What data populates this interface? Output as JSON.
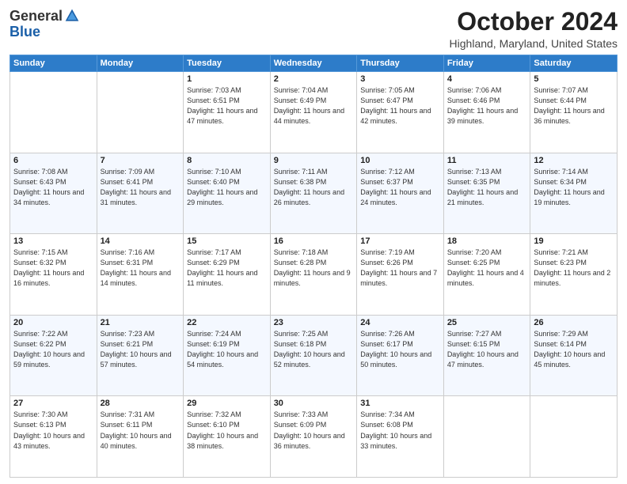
{
  "header": {
    "logo_general": "General",
    "logo_blue": "Blue",
    "title": "October 2024",
    "subtitle": "Highland, Maryland, United States"
  },
  "calendar": {
    "days_of_week": [
      "Sunday",
      "Monday",
      "Tuesday",
      "Wednesday",
      "Thursday",
      "Friday",
      "Saturday"
    ],
    "weeks": [
      [
        {
          "day": "",
          "info": ""
        },
        {
          "day": "",
          "info": ""
        },
        {
          "day": "1",
          "info": "Sunrise: 7:03 AM\nSunset: 6:51 PM\nDaylight: 11 hours and 47 minutes."
        },
        {
          "day": "2",
          "info": "Sunrise: 7:04 AM\nSunset: 6:49 PM\nDaylight: 11 hours and 44 minutes."
        },
        {
          "day": "3",
          "info": "Sunrise: 7:05 AM\nSunset: 6:47 PM\nDaylight: 11 hours and 42 minutes."
        },
        {
          "day": "4",
          "info": "Sunrise: 7:06 AM\nSunset: 6:46 PM\nDaylight: 11 hours and 39 minutes."
        },
        {
          "day": "5",
          "info": "Sunrise: 7:07 AM\nSunset: 6:44 PM\nDaylight: 11 hours and 36 minutes."
        }
      ],
      [
        {
          "day": "6",
          "info": "Sunrise: 7:08 AM\nSunset: 6:43 PM\nDaylight: 11 hours and 34 minutes."
        },
        {
          "day": "7",
          "info": "Sunrise: 7:09 AM\nSunset: 6:41 PM\nDaylight: 11 hours and 31 minutes."
        },
        {
          "day": "8",
          "info": "Sunrise: 7:10 AM\nSunset: 6:40 PM\nDaylight: 11 hours and 29 minutes."
        },
        {
          "day": "9",
          "info": "Sunrise: 7:11 AM\nSunset: 6:38 PM\nDaylight: 11 hours and 26 minutes."
        },
        {
          "day": "10",
          "info": "Sunrise: 7:12 AM\nSunset: 6:37 PM\nDaylight: 11 hours and 24 minutes."
        },
        {
          "day": "11",
          "info": "Sunrise: 7:13 AM\nSunset: 6:35 PM\nDaylight: 11 hours and 21 minutes."
        },
        {
          "day": "12",
          "info": "Sunrise: 7:14 AM\nSunset: 6:34 PM\nDaylight: 11 hours and 19 minutes."
        }
      ],
      [
        {
          "day": "13",
          "info": "Sunrise: 7:15 AM\nSunset: 6:32 PM\nDaylight: 11 hours and 16 minutes."
        },
        {
          "day": "14",
          "info": "Sunrise: 7:16 AM\nSunset: 6:31 PM\nDaylight: 11 hours and 14 minutes."
        },
        {
          "day": "15",
          "info": "Sunrise: 7:17 AM\nSunset: 6:29 PM\nDaylight: 11 hours and 11 minutes."
        },
        {
          "day": "16",
          "info": "Sunrise: 7:18 AM\nSunset: 6:28 PM\nDaylight: 11 hours and 9 minutes."
        },
        {
          "day": "17",
          "info": "Sunrise: 7:19 AM\nSunset: 6:26 PM\nDaylight: 11 hours and 7 minutes."
        },
        {
          "day": "18",
          "info": "Sunrise: 7:20 AM\nSunset: 6:25 PM\nDaylight: 11 hours and 4 minutes."
        },
        {
          "day": "19",
          "info": "Sunrise: 7:21 AM\nSunset: 6:23 PM\nDaylight: 11 hours and 2 minutes."
        }
      ],
      [
        {
          "day": "20",
          "info": "Sunrise: 7:22 AM\nSunset: 6:22 PM\nDaylight: 10 hours and 59 minutes."
        },
        {
          "day": "21",
          "info": "Sunrise: 7:23 AM\nSunset: 6:21 PM\nDaylight: 10 hours and 57 minutes."
        },
        {
          "day": "22",
          "info": "Sunrise: 7:24 AM\nSunset: 6:19 PM\nDaylight: 10 hours and 54 minutes."
        },
        {
          "day": "23",
          "info": "Sunrise: 7:25 AM\nSunset: 6:18 PM\nDaylight: 10 hours and 52 minutes."
        },
        {
          "day": "24",
          "info": "Sunrise: 7:26 AM\nSunset: 6:17 PM\nDaylight: 10 hours and 50 minutes."
        },
        {
          "day": "25",
          "info": "Sunrise: 7:27 AM\nSunset: 6:15 PM\nDaylight: 10 hours and 47 minutes."
        },
        {
          "day": "26",
          "info": "Sunrise: 7:29 AM\nSunset: 6:14 PM\nDaylight: 10 hours and 45 minutes."
        }
      ],
      [
        {
          "day": "27",
          "info": "Sunrise: 7:30 AM\nSunset: 6:13 PM\nDaylight: 10 hours and 43 minutes."
        },
        {
          "day": "28",
          "info": "Sunrise: 7:31 AM\nSunset: 6:11 PM\nDaylight: 10 hours and 40 minutes."
        },
        {
          "day": "29",
          "info": "Sunrise: 7:32 AM\nSunset: 6:10 PM\nDaylight: 10 hours and 38 minutes."
        },
        {
          "day": "30",
          "info": "Sunrise: 7:33 AM\nSunset: 6:09 PM\nDaylight: 10 hours and 36 minutes."
        },
        {
          "day": "31",
          "info": "Sunrise: 7:34 AM\nSunset: 6:08 PM\nDaylight: 10 hours and 33 minutes."
        },
        {
          "day": "",
          "info": ""
        },
        {
          "day": "",
          "info": ""
        }
      ]
    ]
  }
}
